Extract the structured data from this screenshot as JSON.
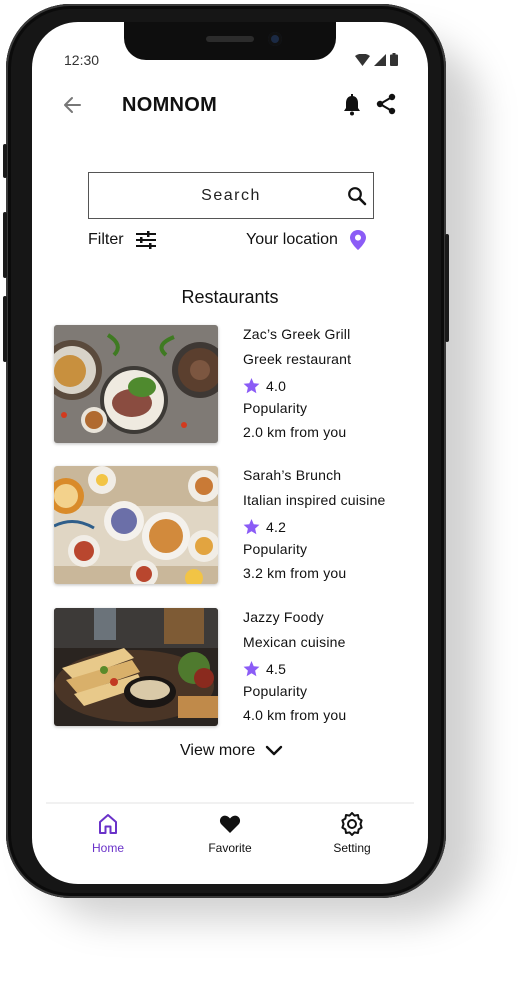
{
  "status_bar": {
    "time": "12:30"
  },
  "header": {
    "title": "NOMNOM"
  },
  "search": {
    "placeholder": "Search"
  },
  "filter": {
    "label": "Filter"
  },
  "location": {
    "label": "Your location"
  },
  "colors": {
    "accent": "#8b5cf6",
    "nav_active": "#6a32c9"
  },
  "section": {
    "title": "Restaurants"
  },
  "restaurants": [
    {
      "name": "Zac’s Greek Grill",
      "cuisine": "Greek restaurant",
      "rating": "4.0",
      "popularity_label": "Popularity",
      "distance": "2.0 km from you"
    },
    {
      "name": "Sarah’s Brunch",
      "cuisine": "Italian inspired cuisine",
      "rating": "4.2",
      "popularity_label": "Popularity",
      "distance": "3.2 km from you"
    },
    {
      "name": "Jazzy Foody",
      "cuisine": "Mexican cuisine",
      "rating": "4.5",
      "popularity_label": "Popularity",
      "distance": "4.0 km from you"
    }
  ],
  "view_more": {
    "label": "View more"
  },
  "bottom_nav": [
    {
      "label": "Home",
      "icon": "home-icon",
      "active": true
    },
    {
      "label": "Favorite",
      "icon": "heart-icon",
      "active": false
    },
    {
      "label": "Setting",
      "icon": "settings-icon",
      "active": false
    }
  ]
}
